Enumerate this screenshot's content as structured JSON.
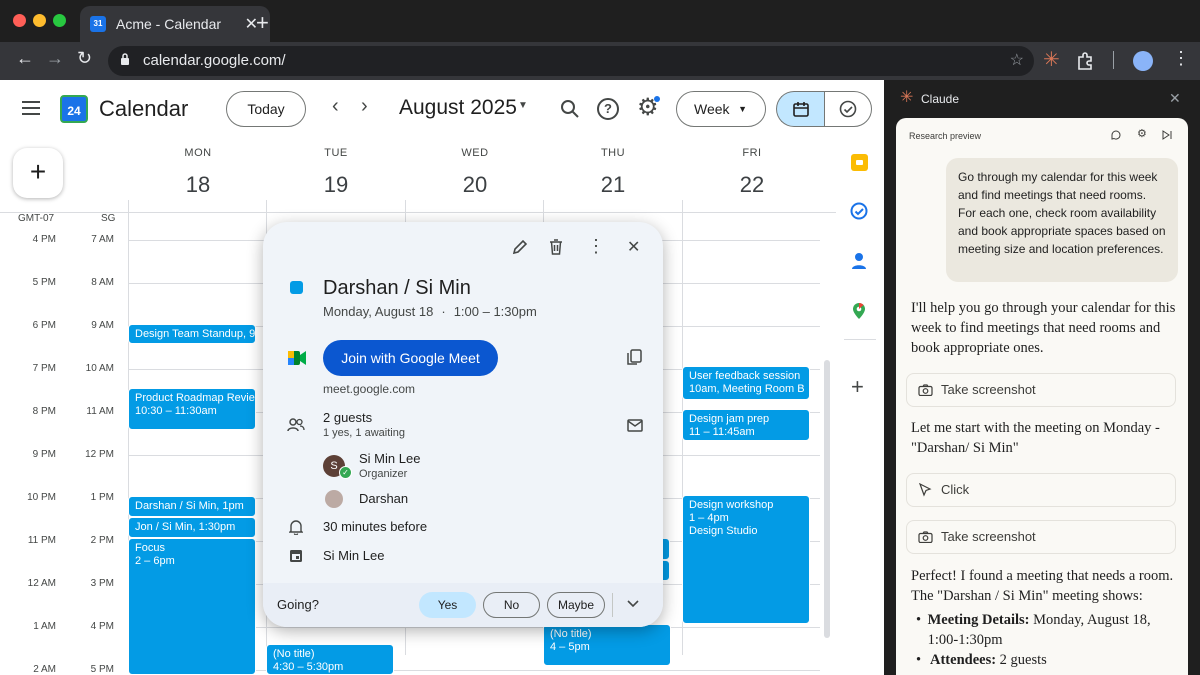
{
  "browser": {
    "tab_title": "Acme - Calendar",
    "url": "calendar.google.com/",
    "favicon_text": "31",
    "colors": {
      "close": "#ff5f57",
      "minimize": "#febc2e",
      "maximize": "#28c840"
    }
  },
  "calendar": {
    "app_name": "Calendar",
    "logo_day": "24",
    "today_label": "Today",
    "month_label": "August 2025",
    "view_label": "Week",
    "timezones": {
      "primary": "GMT-07",
      "secondary": "SG"
    },
    "days": [
      {
        "name": "MON",
        "num": "18"
      },
      {
        "name": "TUE",
        "num": "19"
      },
      {
        "name": "WED",
        "num": "20"
      },
      {
        "name": "THU",
        "num": "21"
      },
      {
        "name": "FRI",
        "num": "22"
      }
    ],
    "times": [
      {
        "primary": "4 PM",
        "secondary": "7 AM"
      },
      {
        "primary": "5 PM",
        "secondary": "8 AM"
      },
      {
        "primary": "6 PM",
        "secondary": "9 AM"
      },
      {
        "primary": "7 PM",
        "secondary": "10 AM"
      },
      {
        "primary": "8 PM",
        "secondary": "11 AM"
      },
      {
        "primary": "9 PM",
        "secondary": "12 PM"
      },
      {
        "primary": "10 PM",
        "secondary": "1 PM"
      },
      {
        "primary": "11 PM",
        "secondary": "2 PM"
      },
      {
        "primary": "12 AM",
        "secondary": "3 PM"
      },
      {
        "primary": "1 AM",
        "secondary": "4 PM"
      },
      {
        "primary": "2 AM",
        "secondary": "5 PM"
      }
    ],
    "events": {
      "standup": {
        "title": "Design Team Standup, 9"
      },
      "roadmap": {
        "title": "Product Roadmap Revie",
        "time": "10:30 – 11:30am"
      },
      "darshan": {
        "title": "Darshan / Si Min, 1pm"
      },
      "jon": {
        "title": "Jon / Si Min, 1:30pm"
      },
      "focus": {
        "title": "Focus",
        "time": "2 – 6pm"
      },
      "notitle_tue": {
        "title": "(No title)",
        "time": "4:30 – 5:30pm"
      },
      "notitle_thu": {
        "title": "(No title)",
        "time": "4 – 5pm"
      },
      "feedback": {
        "title": "User feedback session",
        "time": "10am, Meeting Room B"
      },
      "jam": {
        "title": "Design jam prep",
        "time": "11 – 11:45am"
      },
      "workshop": {
        "title": "Design workshop",
        "time": "1 – 4pm",
        "location": "Design Studio"
      }
    },
    "event_color": "#039be5"
  },
  "popup": {
    "title": "Darshan / Si Min",
    "date": "Monday, August 18",
    "separator": "·",
    "time": "1:00 – 1:30pm",
    "join_label": "Join with Google Meet",
    "meet_url": "meet.google.com",
    "guests_count": "2 guests",
    "guests_status": "1 yes, 1 awaiting",
    "guests": [
      {
        "name": "Si Min Lee",
        "role": "Organizer",
        "initial": "S"
      },
      {
        "name": "Darshan",
        "role": ""
      }
    ],
    "reminder": "30 minutes before",
    "calendar_owner": "Si Min Lee",
    "going_label": "Going?",
    "rsvp": {
      "yes": "Yes",
      "no": "No",
      "maybe": "Maybe"
    },
    "color": "#039be5"
  },
  "claude": {
    "title": "Claude",
    "subtitle": "Research preview",
    "user_message": "Go through my calendar for this week and find meetings that need rooms. For each one, check room availability and book appropriate spaces based on meeting size and location preferences.",
    "msg1": "I'll help you go through your calendar for this week to find meetings that need rooms and book appropriate ones.",
    "tool1": "Take screenshot",
    "msg2": "Let me start with the meeting on Monday - \"Darshan/ Si Min\"",
    "tool2": "Click",
    "tool3": "Take screenshot",
    "msg3": "Perfect! I found a meeting that needs a room. The \"Darshan / Si Min\" meeting shows:",
    "bullets": [
      {
        "label": "Meeting Details:",
        "text": " Monday, August 18, 1:00-1:30pm"
      },
      {
        "label": "Attendees:",
        "text": " 2 guests"
      }
    ],
    "accent": "#d97757"
  }
}
